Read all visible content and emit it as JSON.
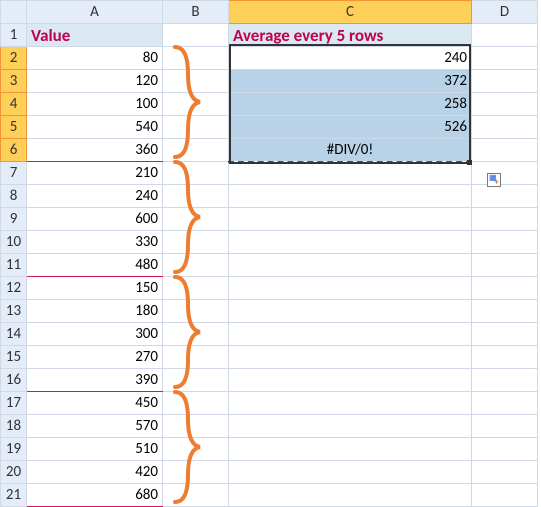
{
  "columns": {
    "rowhdr": "",
    "A": "A",
    "B": "B",
    "C": "C",
    "D": "D"
  },
  "header": {
    "A": "Value",
    "C": "Average every 5 rows"
  },
  "colA": [
    "80",
    "120",
    "100",
    "540",
    "360",
    "210",
    "240",
    "600",
    "330",
    "480",
    "150",
    "180",
    "300",
    "270",
    "390",
    "450",
    "570",
    "510",
    "420",
    "680"
  ],
  "colC": [
    "240",
    "372",
    "258",
    "526",
    "#DIV/0!"
  ],
  "rownums": [
    "1",
    "2",
    "3",
    "4",
    "5",
    "6",
    "7",
    "8",
    "9",
    "10",
    "11",
    "12",
    "13",
    "14",
    "15",
    "16",
    "17",
    "18",
    "19",
    "20",
    "21"
  ],
  "chart_data": {
    "type": "table",
    "title": "Average every 5 rows",
    "groups": [
      {
        "values": [
          80,
          120,
          100,
          540,
          360
        ],
        "avg": 240
      },
      {
        "values": [
          210,
          240,
          600,
          330,
          480
        ],
        "avg": 372
      },
      {
        "values": [
          150,
          180,
          300,
          270,
          390
        ],
        "avg": 258
      },
      {
        "values": [
          450,
          570,
          510,
          420,
          680
        ],
        "avg": 526
      }
    ],
    "error_row": "#DIV/0!"
  }
}
